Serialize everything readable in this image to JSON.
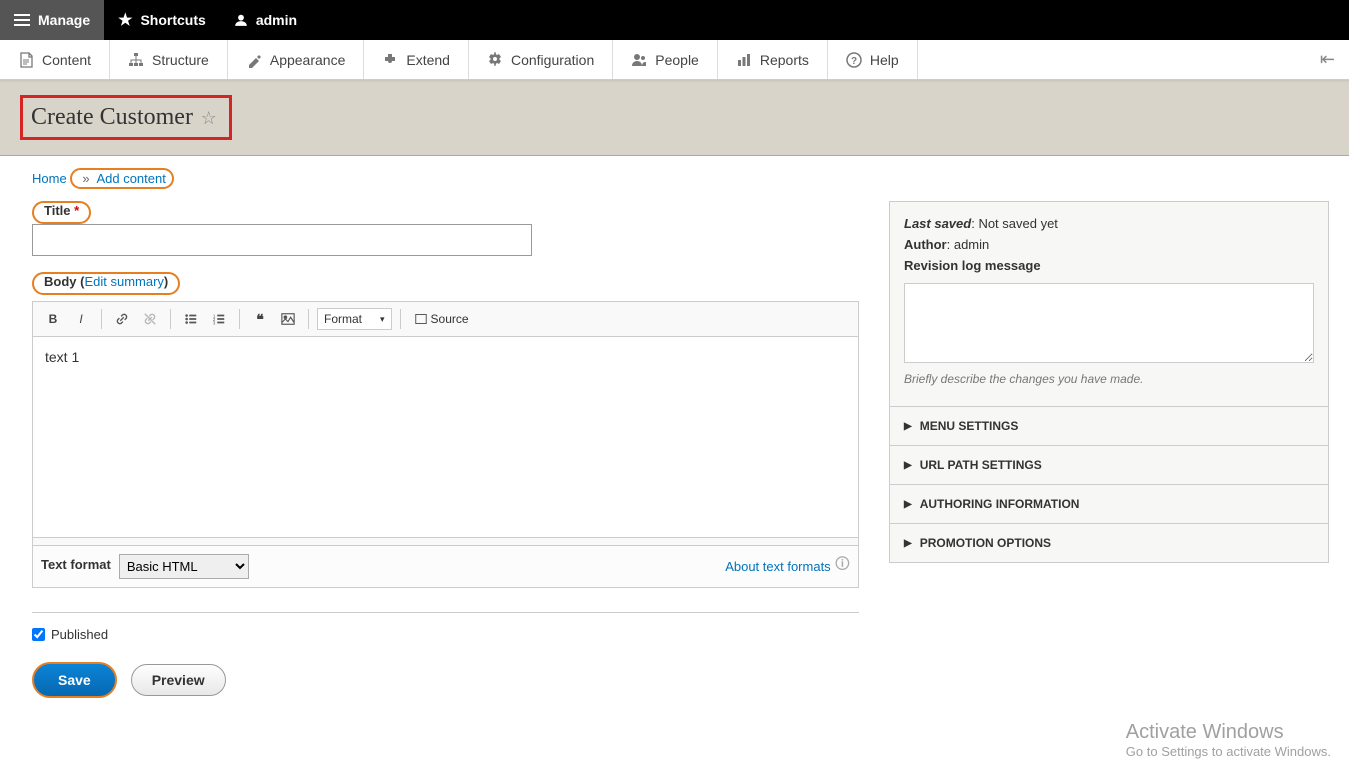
{
  "topbar": {
    "manage": "Manage",
    "shortcuts": "Shortcuts",
    "user": "admin"
  },
  "admin_menu": {
    "content": "Content",
    "structure": "Structure",
    "appearance": "Appearance",
    "extend": "Extend",
    "configuration": "Configuration",
    "people": "People",
    "reports": "Reports",
    "help": "Help"
  },
  "page_title": "Create Customer",
  "breadcrumb": {
    "home": "Home",
    "add_content": "Add content"
  },
  "form": {
    "title_label": "Title",
    "title_value": "",
    "body_label": "Body",
    "edit_summary": "Edit summary",
    "body_content": "text 1",
    "toolbar": {
      "format": "Format",
      "source": "Source"
    },
    "text_format_label": "Text format",
    "text_format_value": "Basic HTML",
    "about_formats": "About text formats",
    "published": "Published",
    "save": "Save",
    "preview": "Preview"
  },
  "sidebar": {
    "last_saved_label": "Last saved",
    "last_saved_value": "Not saved yet",
    "author_label": "Author",
    "author_value": "admin",
    "revision_label": "Revision log message",
    "revision_hint": "Briefly describe the changes you have made.",
    "accordion": {
      "menu": "MENU SETTINGS",
      "url": "URL PATH SETTINGS",
      "authoring": "AUTHORING INFORMATION",
      "promotion": "PROMOTION OPTIONS"
    }
  },
  "watermark": {
    "line1": "Activate Windows",
    "line2": "Go to Settings to activate Windows."
  }
}
